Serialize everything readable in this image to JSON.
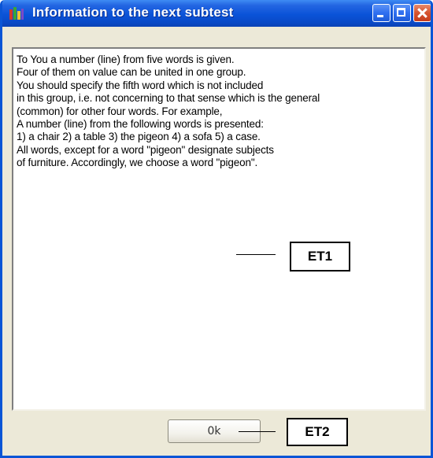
{
  "window": {
    "title": "Information to the next subtest"
  },
  "content": {
    "lines": [
      "To You a number (line) from five words is given.",
      "Four of them on value can be united in one group.",
      "You should specify the fifth word which is not included",
      "in this group, i.e. not concerning to that sense which is the general",
      "(common) for other four words. For example,",
      "A number (line) from the following words is presented:",
      "1) a chair 2) a table 3) the pigeon 4) a sofa 5) a case.",
      "All words, except for a word \"pigeon\" designate subjects",
      "of furniture. Accordingly, we choose a word \"pigeon\"."
    ]
  },
  "buttons": {
    "ok_label": "0k"
  },
  "annotations": {
    "et1": "ET1",
    "et2": "ET2"
  },
  "icons": {
    "app": "app-icon",
    "minimize": "minimize-icon",
    "maximize": "maximize-icon",
    "close": "close-icon"
  }
}
